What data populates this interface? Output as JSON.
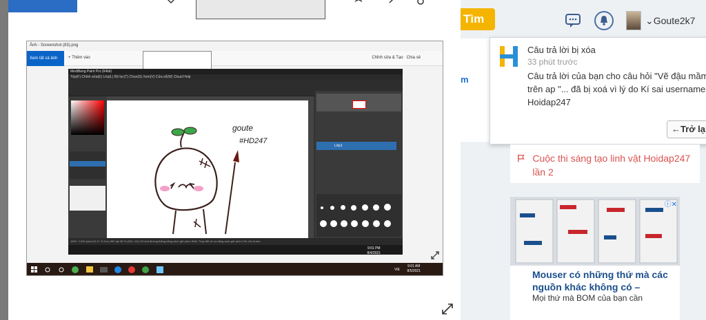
{
  "header": {
    "search_button": "Tìm",
    "username": "Goute2k7",
    "chevron": "⌄"
  },
  "side": {
    "blue_fragment": "m"
  },
  "notification": {
    "title": "Câu trả lời bị xóa",
    "time": "33 phút trước",
    "body": "Câu trả lời của bạn cho câu hỏi \"Vẽ đậu mầm trên ap \"... đã bị xoá vì lý do Kí sai username Hoidap247",
    "back_button": "←Trở lại"
  },
  "contest": {
    "text": "Cuộc thi sáng tạo linh vật Hoidap247 lần 2"
  },
  "ad": {
    "headline": "Mouser có những thứ mà các nguồn khác không có –",
    "description": "Mọi thứ mà BOM của bạn cần"
  },
  "lightbox": {
    "photos_app": {
      "title": "Ảnh - Screenshot (83).png",
      "see_all": "Xem tất cả ảnh",
      "add_to": "Thêm vào",
      "edit_create": "Chỉnh sửa & Tạo",
      "share": "Chia sẻ"
    },
    "medibang": {
      "title": "MediBang Paint Pro (64bit)",
      "menu": "Tệp(F)  Chỉnh sửa(E)  Lớp(L)  Bộ lọc(T)  Chọn(S)  Xem(V)  Cửa sổ(W)  Cloud  Help",
      "layer_name": "Lớp1",
      "status": "1600 * 1200 pixel  (11.6 * 8.7cm)  350 dpi  88 %  (920, 111)  Vẽ một đường thẳng bằng cách giữ phím Shift, Thay đổi cỡ cọ bằng cách giữ phím Ctrl, Alt và kéo",
      "clock_time": "9:01 PM",
      "clock_date": "8/4/2021"
    },
    "drawing_text": [
      "goute",
      "#HD247"
    ],
    "taskbar": {
      "time": "9:01 AM",
      "date": "8/5/2021",
      "lang": "VIE"
    }
  },
  "colors": {
    "search_button": "#f4b400",
    "contest_text": "#d9534f",
    "ad_headline": "#1a4f8c",
    "photos_accent": "#0a64c8"
  }
}
